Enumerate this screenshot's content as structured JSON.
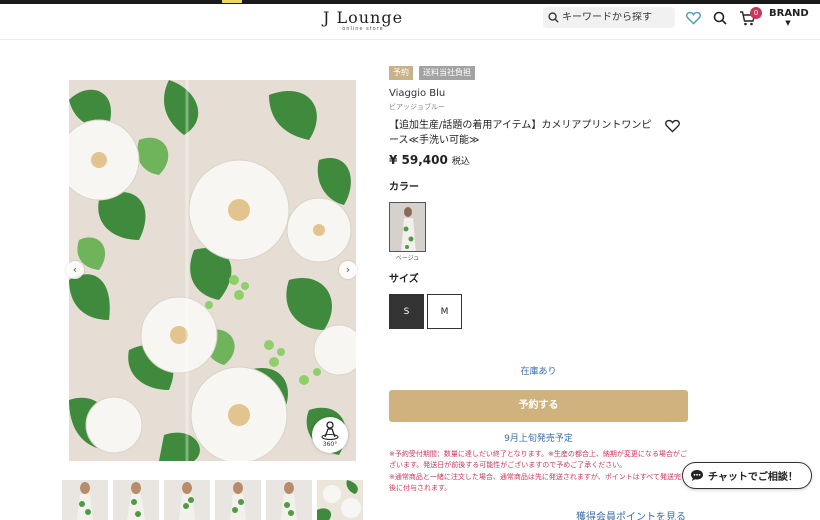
{
  "header": {
    "logo_main": "J Lounge",
    "logo_sub": "online store",
    "search_placeholder": "キーワードから探す",
    "cart_count": "0",
    "brand_menu_label": "BRAND"
  },
  "product": {
    "badges": [
      "予約",
      "送料当社負担"
    ],
    "brand_name": "Viaggio Blu",
    "brand_kana": "ビアッジョブルー",
    "title": "【追加生産/話題の着用アイテム】カメリアプリントワンピース≪手洗い可能≫",
    "price": "¥ 59,400",
    "tax_label": "税込",
    "color_label": "カラー",
    "colors": [
      {
        "name": "ベージュ",
        "selected": true
      }
    ],
    "size_label": "サイズ",
    "sizes": [
      {
        "label": "S",
        "selected": true
      },
      {
        "label": "M",
        "selected": false
      }
    ],
    "stock_status": "在庫あり",
    "reserve_button": "予約する",
    "release_info": "9月上旬発売予定",
    "notes": [
      "※予約受付期間：数量に達しだい終了となります。※生産の都合上、納期が変更になる場合がございます。発送日が前後する可能性がございますので予めご了承ください。",
      "※通常商品と一緒に注文した場合、通常商品は先に発送されますが、ポイントはすべて発送完了後に付与されます。"
    ],
    "points_link": "獲得会員ポイントを見る"
  },
  "gallery": {
    "prev_icon": "chevron-left-icon",
    "next_icon": "chevron-right-icon",
    "view_360_label": "360°",
    "thumbnail_count": 6
  },
  "chat": {
    "label": "チャットでご相談！"
  },
  "colors": {
    "accent_gold": "#cfb27d",
    "badge_gold": "#c9b28a",
    "link_blue": "#3a6ea5",
    "note_red": "#c8365b"
  }
}
